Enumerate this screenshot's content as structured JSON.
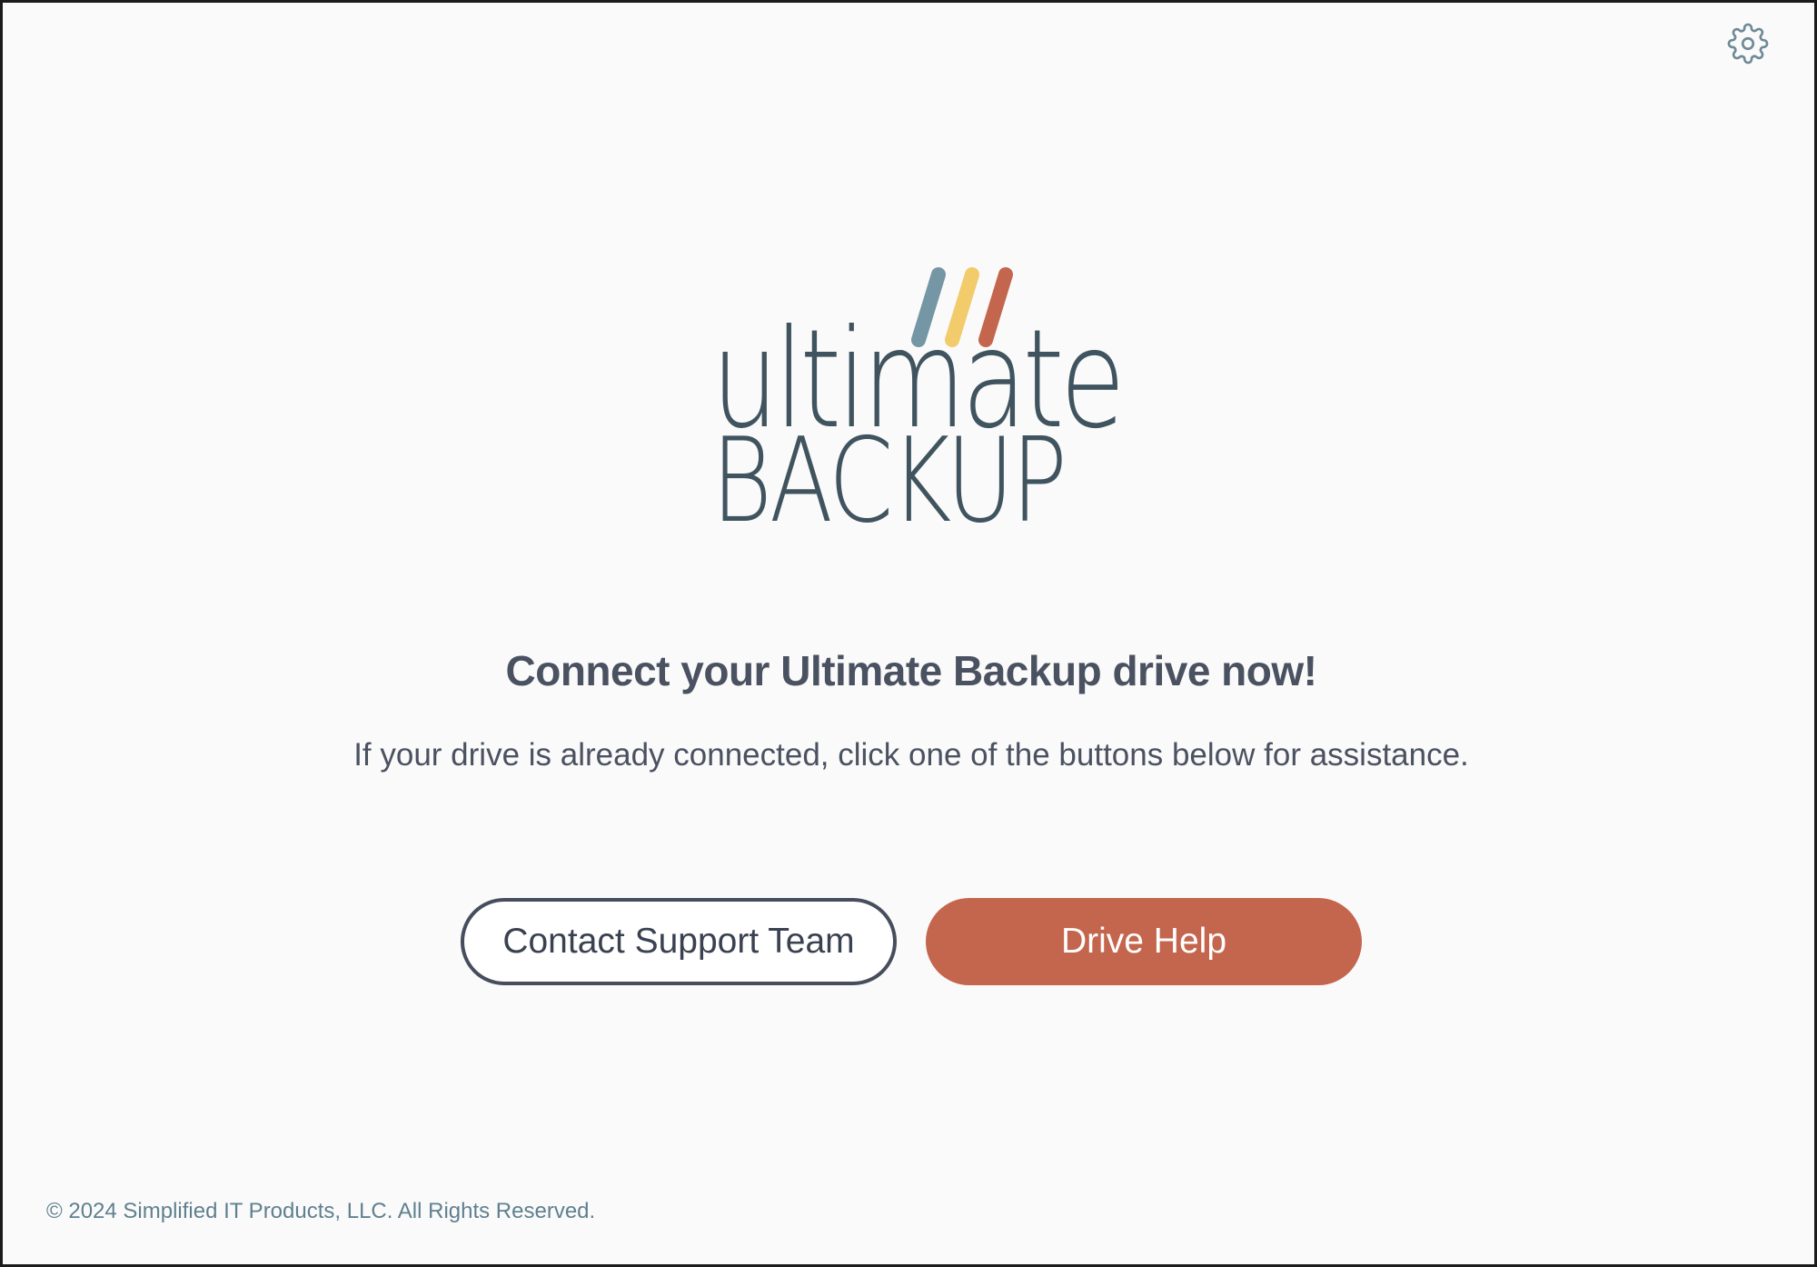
{
  "app": {
    "logo": {
      "word_top": "ultimate",
      "word_bottom": "BACKUP",
      "stripe_colors": [
        "#7496a5",
        "#f2cb6a",
        "#c4664d"
      ],
      "text_color": "#40545f"
    },
    "settings_icon": "gear-icon"
  },
  "main": {
    "headline": "Connect your Ultimate Backup drive now!",
    "subtext": "If your drive is already connected, click one of the buttons below for assistance."
  },
  "buttons": {
    "contact_support": "Contact Support Team",
    "drive_help": "Drive Help"
  },
  "colors": {
    "accent": "#c4664d",
    "text": "#4a5160",
    "footer": "#60808f",
    "background": "#fafafa"
  },
  "footer": {
    "copyright": "© 2024 Simplified IT Products, LLC. All Rights Reserved."
  }
}
